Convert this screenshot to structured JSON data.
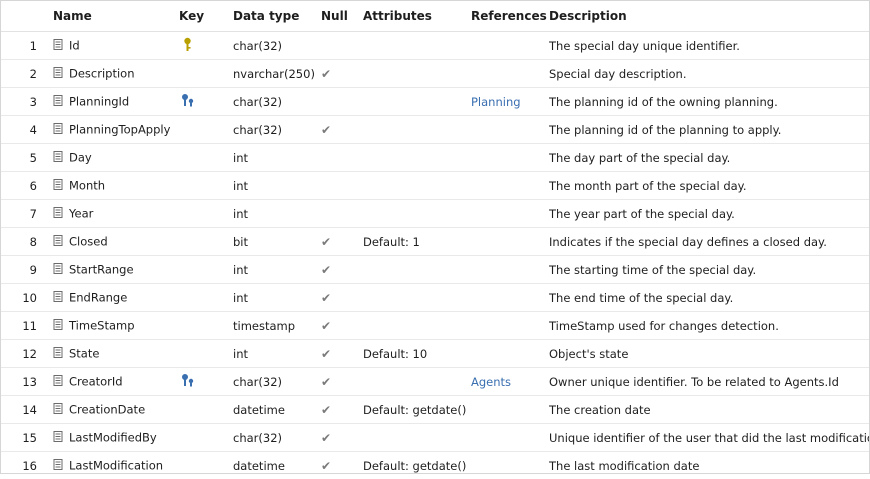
{
  "headers": {
    "num": "",
    "name": "Name",
    "key": "Key",
    "type": "Data type",
    "null": "Null",
    "attributes": "Attributes",
    "references": "References",
    "description": "Description"
  },
  "colors": {
    "reference": "#3a6fb0",
    "pk_key": "#b8a000",
    "fk_key": "#3a6fb0",
    "check": "#7a7a7a"
  },
  "rows": [
    {
      "num": "1",
      "name": "Id",
      "key": "primary-key",
      "type": "char(32)",
      "null": false,
      "attributes": "",
      "references": "",
      "description": "The special day unique identifier."
    },
    {
      "num": "2",
      "name": "Description",
      "key": "",
      "type": "nvarchar(250)",
      "null": true,
      "attributes": "",
      "references": "",
      "description": "Special day description."
    },
    {
      "num": "3",
      "name": "PlanningId",
      "key": "foreign-key",
      "type": "char(32)",
      "null": false,
      "attributes": "",
      "references": "Planning",
      "description": "The planning id of the owning planning."
    },
    {
      "num": "4",
      "name": "PlanningTopApply",
      "key": "",
      "type": "char(32)",
      "null": true,
      "attributes": "",
      "references": "",
      "description": "The planning id of the planning to apply."
    },
    {
      "num": "5",
      "name": "Day",
      "key": "",
      "type": "int",
      "null": false,
      "attributes": "",
      "references": "",
      "description": "The day part of the special day."
    },
    {
      "num": "6",
      "name": "Month",
      "key": "",
      "type": "int",
      "null": false,
      "attributes": "",
      "references": "",
      "description": "The month part of the special day."
    },
    {
      "num": "7",
      "name": "Year",
      "key": "",
      "type": "int",
      "null": false,
      "attributes": "",
      "references": "",
      "description": "The year part of the special day."
    },
    {
      "num": "8",
      "name": "Closed",
      "key": "",
      "type": "bit",
      "null": true,
      "attributes": "Default: 1",
      "references": "",
      "description": "Indicates if the special day defines a closed day."
    },
    {
      "num": "9",
      "name": "StartRange",
      "key": "",
      "type": "int",
      "null": true,
      "attributes": "",
      "references": "",
      "description": "The starting time of the special day."
    },
    {
      "num": "10",
      "name": "EndRange",
      "key": "",
      "type": "int",
      "null": true,
      "attributes": "",
      "references": "",
      "description": "The end time of the special day."
    },
    {
      "num": "11",
      "name": "TimeStamp",
      "key": "",
      "type": "timestamp",
      "null": true,
      "attributes": "",
      "references": "",
      "description": "TimeStamp used for changes detection."
    },
    {
      "num": "12",
      "name": "State",
      "key": "",
      "type": "int",
      "null": true,
      "attributes": "Default: 10",
      "references": "",
      "description": "Object's state"
    },
    {
      "num": "13",
      "name": "CreatorId",
      "key": "foreign-key",
      "type": "char(32)",
      "null": true,
      "attributes": "",
      "references": "Agents",
      "description": "Owner unique identifier. To be related to Agents.Id"
    },
    {
      "num": "14",
      "name": "CreationDate",
      "key": "",
      "type": "datetime",
      "null": true,
      "attributes": "Default: getdate()",
      "references": "",
      "description": "The creation date"
    },
    {
      "num": "15",
      "name": "LastModifiedBy",
      "key": "",
      "type": "char(32)",
      "null": true,
      "attributes": "",
      "references": "",
      "description": "Unique identifier of the user that did the last modifications"
    },
    {
      "num": "16",
      "name": "LastModification",
      "key": "",
      "type": "datetime",
      "null": true,
      "attributes": "Default: getdate()",
      "references": "",
      "description": "The last modification date"
    }
  ]
}
